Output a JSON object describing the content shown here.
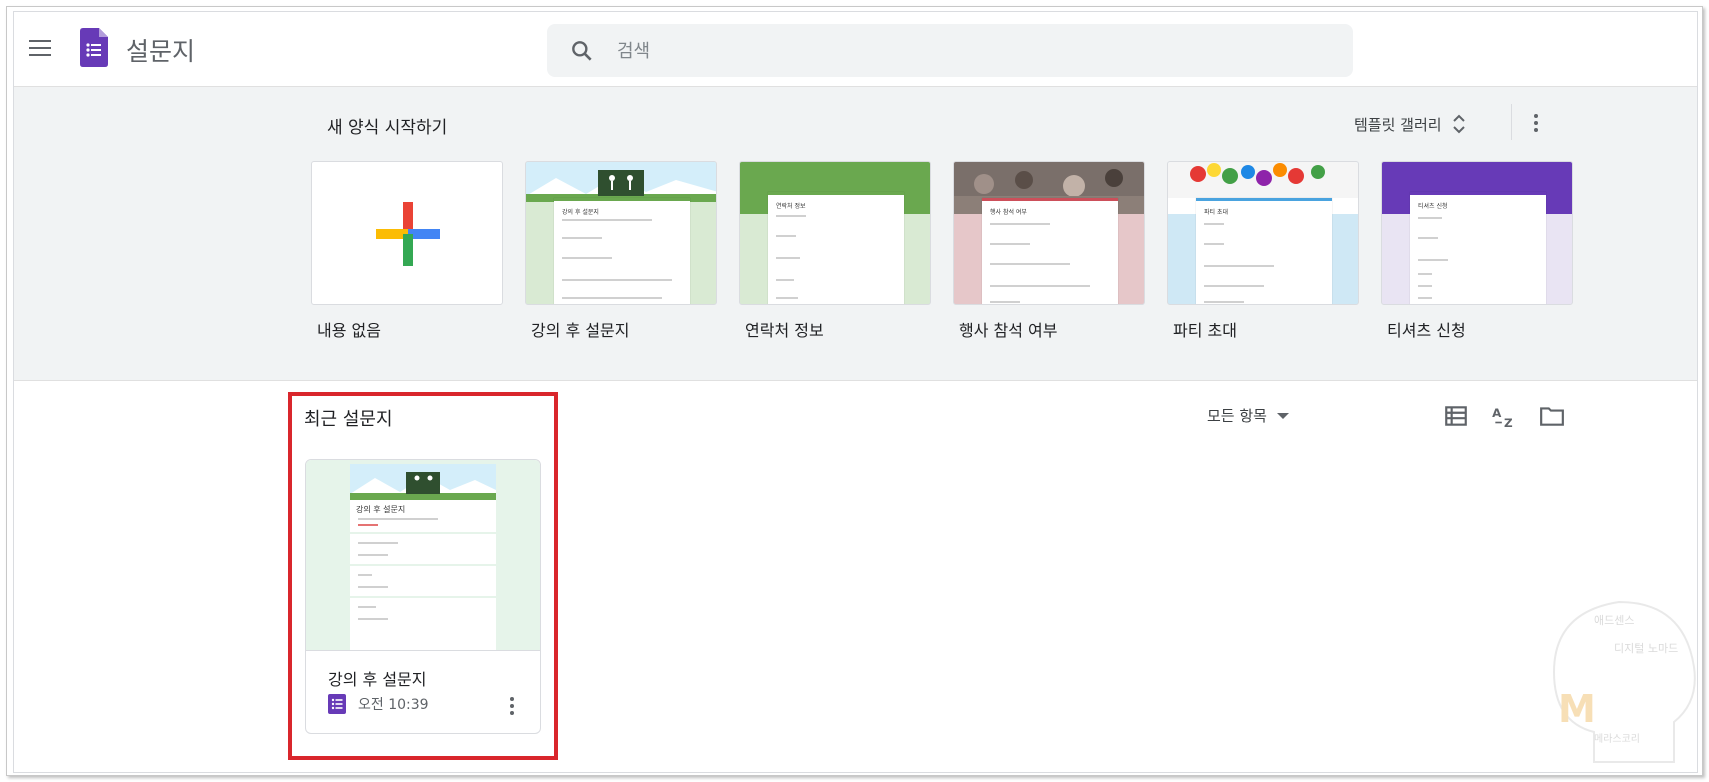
{
  "app": {
    "title": "설문지"
  },
  "search": {
    "placeholder": "검색"
  },
  "templates": {
    "section_title": "새 양식 시작하기",
    "gallery_label": "템플릿 갤러리",
    "items": [
      {
        "label": "내용 없음",
        "thumb_title": ""
      },
      {
        "label": "강의 후 설문지",
        "thumb_title": "강의 후 설문지"
      },
      {
        "label": "연락처 정보",
        "thumb_title": "연락처 정보"
      },
      {
        "label": "행사 참석 여부",
        "thumb_title": "행사 참석 여부"
      },
      {
        "label": "파티 초대",
        "thumb_title": "파티 초대"
      },
      {
        "label": "티셔츠 신청",
        "thumb_title": "티셔츠 신청"
      }
    ]
  },
  "recent": {
    "title": "최근 설문지",
    "filter_label": "모든 항목",
    "docs": [
      {
        "name": "강의 후 설문지",
        "time": "오전 10:39",
        "thumb_title": "강의 후 설문지"
      }
    ]
  },
  "colors": {
    "forms_purple": "#673ab7",
    "highlight_red": "#d9262c",
    "template_bg": "#f1f3f4"
  },
  "watermark": {
    "text_top": "애드센스",
    "text_mid": "디지털 노마드",
    "text_bottom": "메라스코리",
    "letter": "M"
  }
}
